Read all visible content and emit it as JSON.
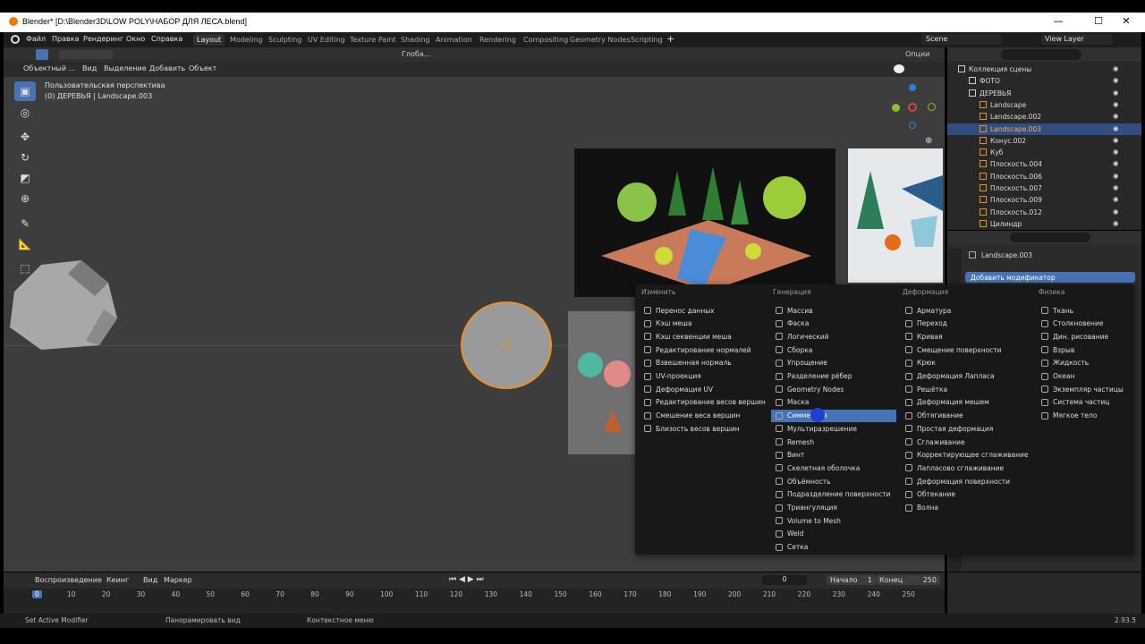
{
  "window": {
    "title": "Blender* [D:\\Blender3D\\LOW POLY\\НАБОР ДЛЯ ЛЕСА.blend]",
    "minimize": "—",
    "maximize": "☐",
    "close": "✕"
  },
  "menu": {
    "items": [
      "Файл",
      "Правка",
      "Рендеринг",
      "Окно",
      "Справка"
    ]
  },
  "workspaces": [
    "Layout",
    "Modeling",
    "Sculpting",
    "UV Editing",
    "Texture Paint",
    "Shading",
    "Animation",
    "Rendering",
    "Compositing",
    "Geometry Nodes",
    "Scripting"
  ],
  "scene": {
    "label": "Scene",
    "view_layer": "View Layer"
  },
  "viewport_header": {
    "mode": "Объектный ...",
    "view": "Вид",
    "select": "Выделение",
    "add": "Добавить",
    "object": "Объект",
    "transform": "Глоба...",
    "options": "Опции"
  },
  "viewport": {
    "perspective": "Пользовательская перспектива",
    "object_info": "(0) ДЕРЕВЬЯ | Landscape.003"
  },
  "outliner": {
    "items": [
      {
        "label": "Коллекция сцены",
        "indent": 0
      },
      {
        "label": "ФОТО",
        "indent": 1
      },
      {
        "label": "ДЕРЕВЬЯ",
        "indent": 1
      },
      {
        "label": "Landscape",
        "indent": 2
      },
      {
        "label": "Landscape.002",
        "indent": 2
      },
      {
        "label": "Landscape.003",
        "indent": 2,
        "selected": true
      },
      {
        "label": "Конус.002",
        "indent": 2
      },
      {
        "label": "Куб",
        "indent": 2
      },
      {
        "label": "Плоскость.004",
        "indent": 2
      },
      {
        "label": "Плоскость.006",
        "indent": 2
      },
      {
        "label": "Плоскость.007",
        "indent": 2
      },
      {
        "label": "Плоскость.009",
        "indent": 2
      },
      {
        "label": "Плоскость.012",
        "indent": 2
      },
      {
        "label": "Цилиндр",
        "indent": 2
      }
    ]
  },
  "properties": {
    "object": "Landscape.003",
    "add_modifier": "Добавить модификатор"
  },
  "modifier_menu": {
    "columns": [
      {
        "header": "Изменить",
        "items": [
          "Перенос данных",
          "Кэш меша",
          "Кэш секвенции меша",
          "Редактирование нормалей",
          "Взвешенная нормаль",
          "UV-проекция",
          "Деформация UV",
          "Редактирование весов вершин",
          "Смешение веса вершин",
          "Близость весов вершин"
        ]
      },
      {
        "header": "Генерация",
        "items": [
          "Массив",
          "Фаска",
          "Логический",
          "Сборка",
          "Упрощение",
          "Разделение рёбер",
          "Geometry Nodes",
          "Маска",
          "Симметрия",
          "Мультиразрешение",
          "Remesh",
          "Винт",
          "Скелетная оболочка",
          "Объёмность",
          "Подразделение поверхности",
          "Триангуляция",
          "Volume to Mesh",
          "Weld",
          "Сетка"
        ],
        "highlighted": 8
      },
      {
        "header": "Деформация",
        "items": [
          "Арматура",
          "Переход",
          "Кривая",
          "Смещение поверхности",
          "Крюк",
          "Деформация Лапласа",
          "Решётка",
          "Деформация мешем",
          "Обтягивание",
          "Простая деформация",
          "Сглаживание",
          "Корректирующее сглаживание",
          "Лапласово сглаживание",
          "Деформация поверхности",
          "Обтекание",
          "Волна"
        ]
      },
      {
        "header": "Физика",
        "items": [
          "Ткань",
          "Столкновение",
          "Дин. рисование",
          "Взрыв",
          "Жидкость",
          "Океан",
          "Экземпляр частицы",
          "Система частиц",
          "Мягкое тело"
        ]
      }
    ]
  },
  "timeline": {
    "playback": "Воспроизведение",
    "keying": "Кеинг",
    "view": "Вид",
    "marker": "Маркер",
    "current_frame": "0",
    "start_label": "Начало",
    "start": "1",
    "end_label": "Конец",
    "end": "250",
    "ticks": [
      "0",
      "10",
      "20",
      "30",
      "40",
      "50",
      "60",
      "70",
      "80",
      "90",
      "100",
      "110",
      "120",
      "130",
      "140",
      "150",
      "160",
      "170",
      "180",
      "190",
      "200",
      "210",
      "220",
      "230",
      "240",
      "250"
    ],
    "current_tick": "0"
  },
  "status": {
    "left": "Set Active Modifier",
    "middle": "Панорамировать вид",
    "right": "Контекстное меню",
    "version": "2.93.5"
  },
  "colors": {
    "accent": "#4772b3",
    "selection": "#334d80",
    "orange": "#e87d0d"
  }
}
